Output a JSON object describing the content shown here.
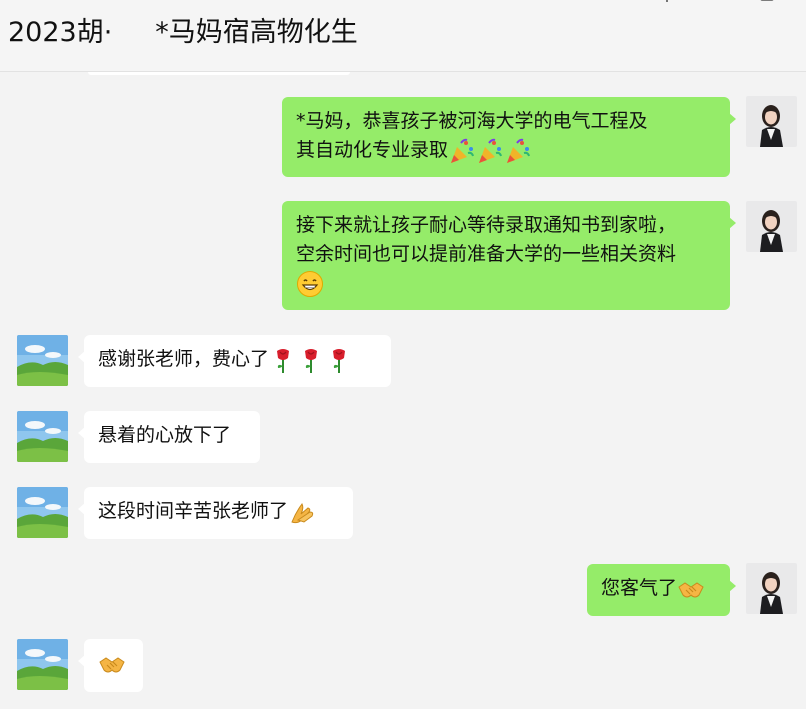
{
  "header": {
    "title": "2023胡·     *马妈宿高物化生",
    "icons": [
      "pin-icon",
      "more-icon"
    ]
  },
  "colors": {
    "outgoing_bubble": "#95ec69",
    "incoming_bubble": "#ffffff",
    "background": "#f3f3f3"
  },
  "messages": [
    {
      "direction": "out",
      "lines": [
        "      *马妈，恭喜孩子被河海大学的电气工程及",
        "其自动化专业录取"
      ],
      "emoji": [
        "party-popper-icon",
        "party-popper-icon",
        "party-popper-icon"
      ],
      "avatar": "teacher-avatar"
    },
    {
      "direction": "out",
      "lines": [
        "接下来就让孩子耐心等待录取通知书到家啦，",
        "空余时间也可以提前准备大学的一些相关资料"
      ],
      "emoji": [
        "grin-icon"
      ],
      "avatar": "teacher-avatar"
    },
    {
      "direction": "in",
      "lines": [
        "感谢张老师，费心了"
      ],
      "emoji": [
        "rose-icon",
        "rose-icon",
        "rose-icon"
      ],
      "avatar": "parent-avatar"
    },
    {
      "direction": "in",
      "lines": [
        "悬着的心放下了"
      ],
      "emoji": [],
      "avatar": "parent-avatar"
    },
    {
      "direction": "in",
      "lines": [
        "这段时间辛苦张老师了"
      ],
      "emoji": [
        "folded-hands-icon"
      ],
      "avatar": "parent-avatar"
    },
    {
      "direction": "out",
      "lines": [
        "您客气了"
      ],
      "emoji": [
        "handshake-icon"
      ],
      "avatar": "teacher-avatar"
    },
    {
      "direction": "in",
      "lines": [
        ""
      ],
      "emoji": [
        "handshake-icon"
      ],
      "avatar": "parent-avatar"
    }
  ]
}
